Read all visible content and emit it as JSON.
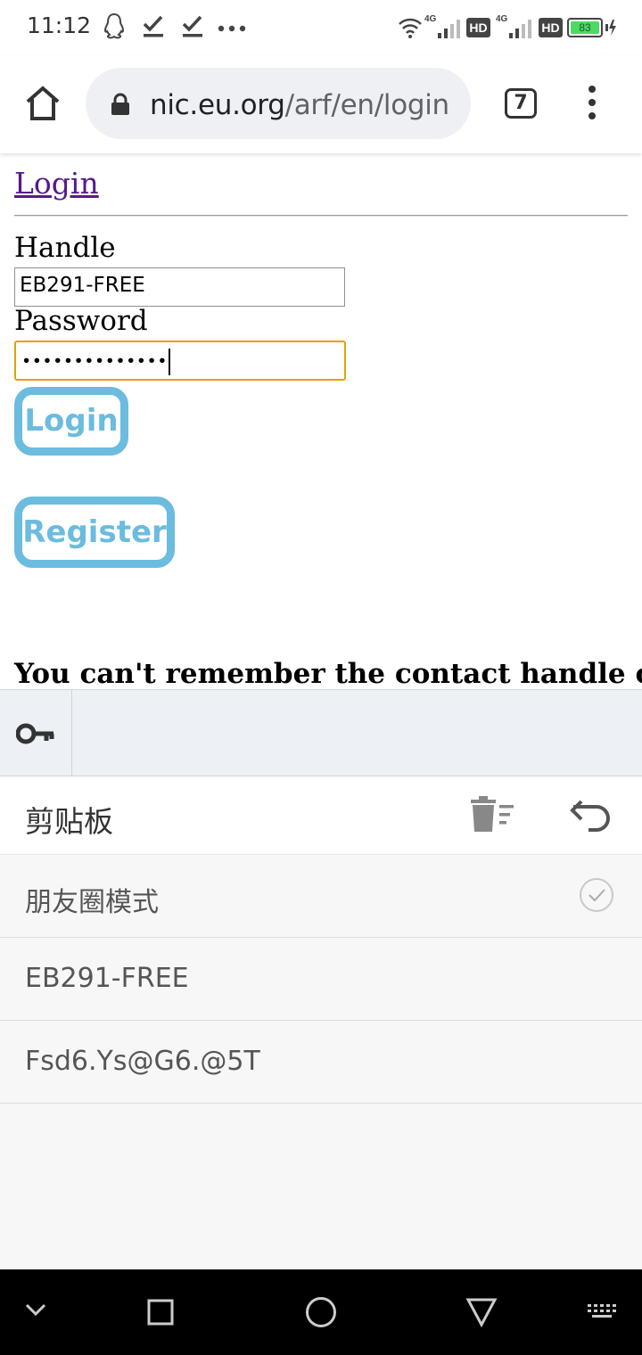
{
  "status_bar": {
    "time": "11:12",
    "battery": "83",
    "network_1": "4G",
    "network_2": "4G",
    "hd_1": "HD",
    "hd_2": "HD"
  },
  "browser": {
    "url_host": "nic.eu.org",
    "url_path": "/arf/en/login",
    "tab_count": "7"
  },
  "page": {
    "login_link": "Login",
    "handle_label": "Handle",
    "handle_value": "EB291-FREE",
    "password_label": "Password",
    "password_mask": "••••••••••••••",
    "login_button": "Login",
    "register_button": "Register",
    "forgot_text": "You can't remember the contact handle or"
  },
  "keyboard_panel": {
    "clipboard_title": "剪贴板",
    "items": [
      {
        "text": "朋友圈模式"
      },
      {
        "text": "EB291-FREE"
      },
      {
        "text": "Fsd6.Ys@G6.@5T"
      }
    ]
  },
  "colors": {
    "button_accent": "#6bbcde",
    "link": "#551a8b",
    "focus_border": "#e3a00a",
    "battery_green": "#4cd964"
  }
}
